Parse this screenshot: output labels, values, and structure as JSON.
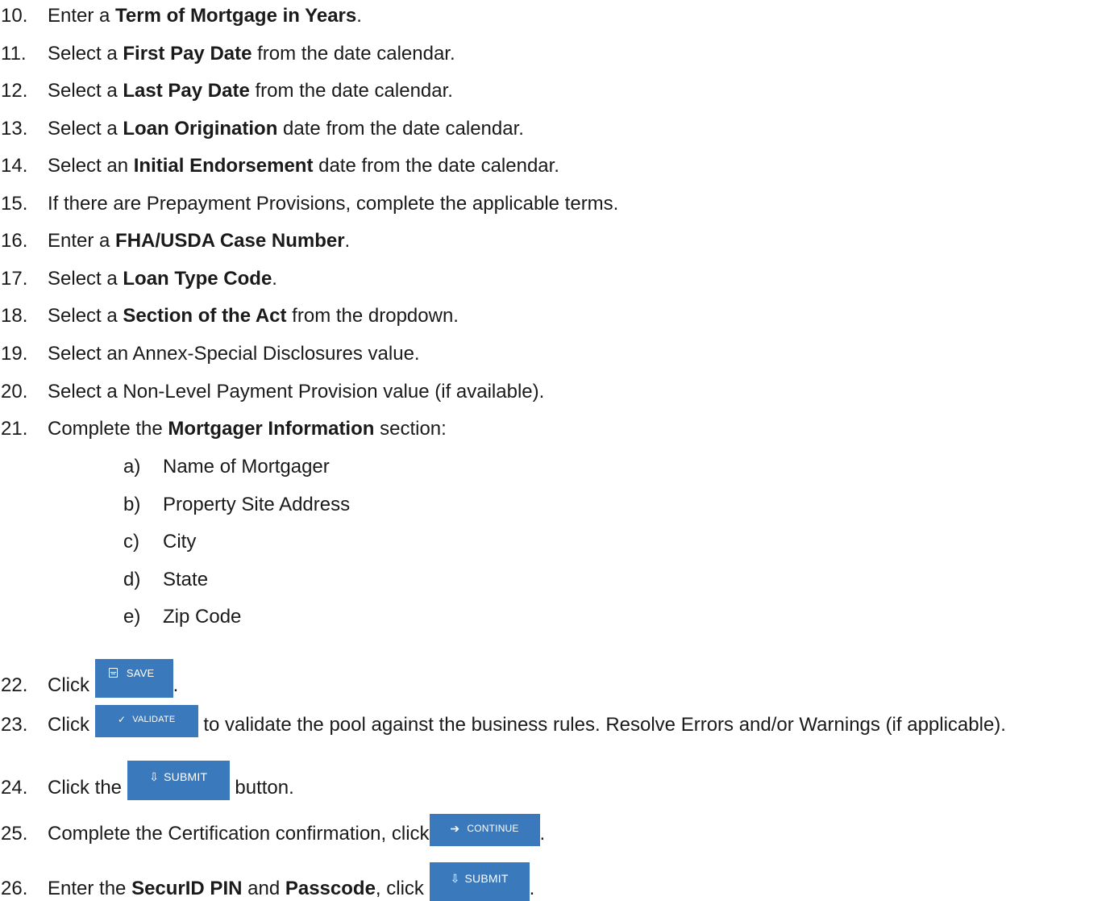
{
  "steps": [
    {
      "num": "10.",
      "pre": "Enter a ",
      "bold": "Term of Mortgage in Years",
      "post": "."
    },
    {
      "num": "11.",
      "pre": "Select a ",
      "bold": "First Pay Date",
      "post": " from the date calendar."
    },
    {
      "num": "12.",
      "pre": "Select a ",
      "bold": "Last Pay Date",
      "post": " from the date calendar."
    },
    {
      "num": "13.",
      "pre": "Select a ",
      "bold": "Loan Origination",
      "post": " date from the date calendar."
    },
    {
      "num": "14.",
      "pre": "Select an ",
      "bold": "Initial Endorsement",
      "post": " date from the date calendar."
    },
    {
      "num": "15.",
      "text": "If there are Prepayment Provisions, complete the applicable terms."
    },
    {
      "num": "16.",
      "pre": "Enter a ",
      "bold": "FHA/USDA Case Number",
      "post": "."
    },
    {
      "num": "17.",
      "pre": "Select a ",
      "bold": "Loan Type Code",
      "post": "."
    },
    {
      "num": "18.",
      "pre": "Select a ",
      "bold": "Section of the Act",
      "post": " from the dropdown."
    },
    {
      "num": "19.",
      "text": "Select an Annex-Special Disclosures value."
    },
    {
      "num": "20.",
      "text": "Select a Non-Level Payment Provision value (if available)."
    },
    {
      "num": "21.",
      "pre": "Complete the ",
      "bold": "Mortgager Information",
      "post": " section:"
    }
  ],
  "substeps": [
    {
      "letter": "a)",
      "text": "Name of Mortgager"
    },
    {
      "letter": "b)",
      "text": "Property Site Address"
    },
    {
      "letter": "c)",
      "text": "City"
    },
    {
      "letter": "d)",
      "text": "State"
    },
    {
      "letter": "e)",
      "text": "Zip Code"
    }
  ],
  "step22": {
    "num": "22.",
    "pre": "Click ",
    "post": ".",
    "button": "SAVE"
  },
  "step23": {
    "num": "23.",
    "pre": "Click ",
    "post": " to validate the pool against the business rules. Resolve Errors and/or Warnings (if applicable).",
    "button": "VALIDATE"
  },
  "step24": {
    "num": "24.",
    "pre": "Click the ",
    "post": " button.",
    "button": "SUBMIT"
  },
  "step25": {
    "num": "25.",
    "pre": "Complete the Certification confirmation, click",
    "post": ".",
    "button": "CONTINUE"
  },
  "step26": {
    "num": "26.",
    "pre1": "Enter the ",
    "bold1": "SecurID PIN",
    "mid": " and ",
    "bold2": "Passcode",
    "pre2": ", click ",
    "post": ".",
    "button": "SUBMIT"
  },
  "colors": {
    "button_bg": "#3b79bd",
    "button_text": "#ffffff",
    "body_text": "#1a1a1a"
  },
  "icons": {
    "save": "floppy-disk-icon",
    "validate": "checkmark-icon",
    "submit": "download-arrow-icon",
    "continue": "arrow-right-icon"
  }
}
